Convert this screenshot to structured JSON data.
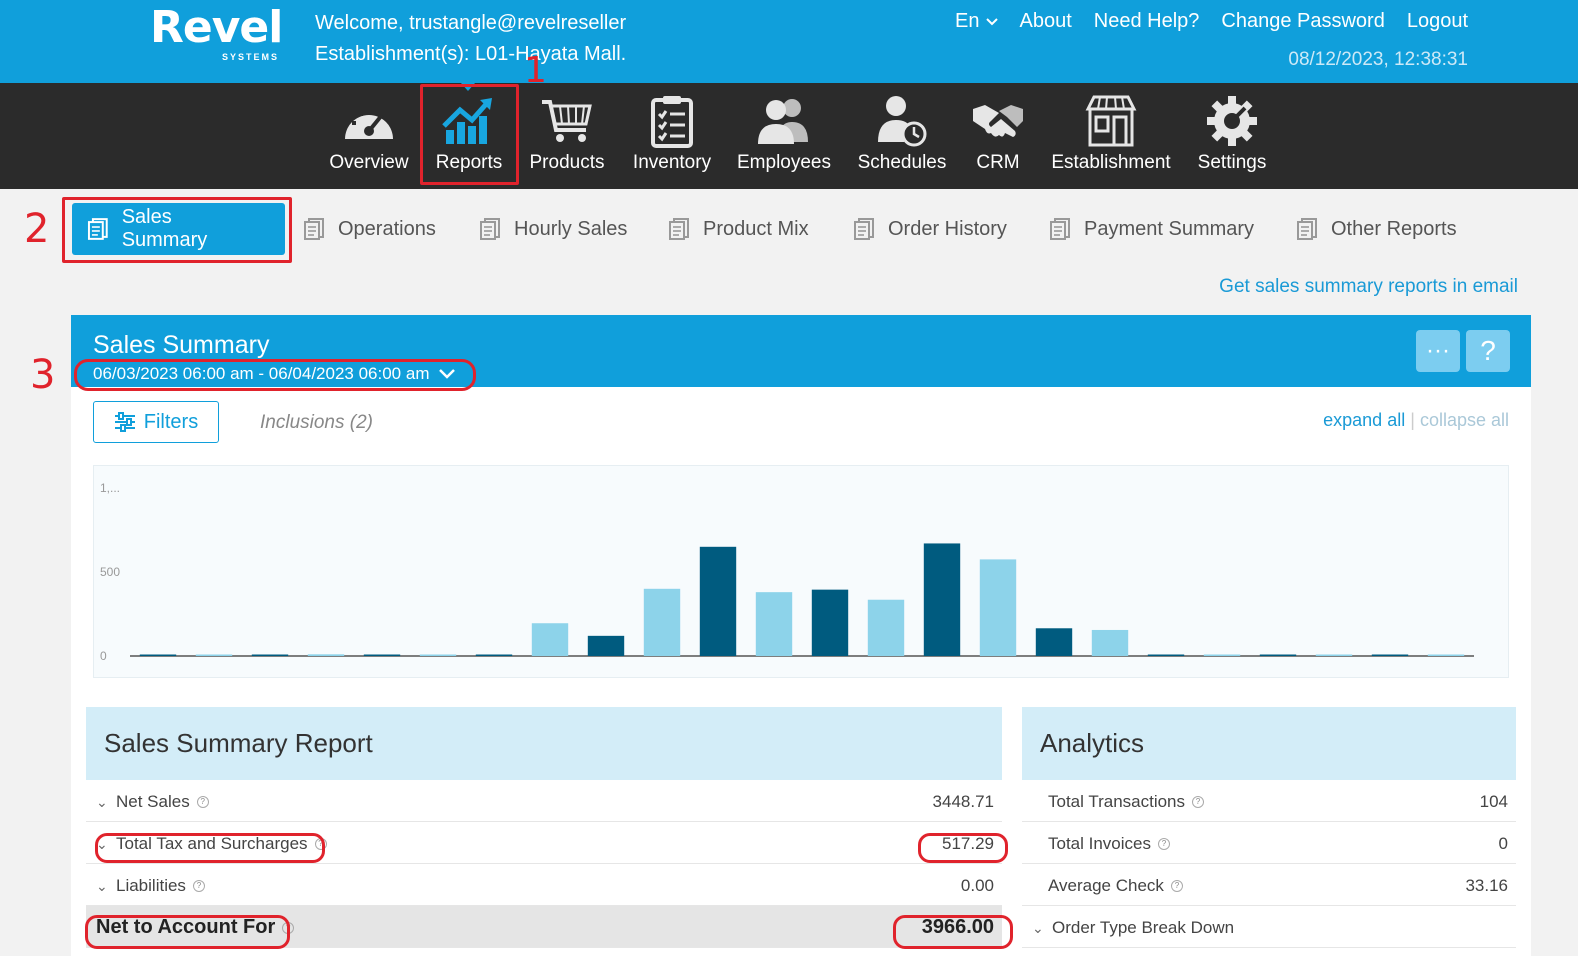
{
  "header": {
    "logo_word": "Revel",
    "logo_sub": "SYSTEMS",
    "welcome": "Welcome, trustangle@revelreseller",
    "establishment": "Establishment(s): L01-Hayata Mall.",
    "links": {
      "lang": "En",
      "about": "About",
      "help": "Need Help?",
      "password": "Change Password",
      "logout": "Logout"
    },
    "datetime": "08/12/2023, 12:38:31"
  },
  "nav": {
    "overview": "Overview",
    "reports": "Reports",
    "products": "Products",
    "inventory": "Inventory",
    "employees": "Employees",
    "schedules": "Schedules",
    "crm": "CRM",
    "establishment": "Establishment",
    "settings": "Settings"
  },
  "annotations": {
    "one": "1",
    "two": "2",
    "three": "3"
  },
  "subtabs": {
    "sales_summary": "Sales Summary",
    "operations": "Operations",
    "hourly_sales": "Hourly Sales",
    "product_mix": "Product Mix",
    "order_history": "Order History",
    "payment_summary": "Payment Summary",
    "other_reports": "Other Reports"
  },
  "email_link": "Get sales summary reports in email",
  "panel": {
    "title": "Sales Summary",
    "date_range": "06/03/2023 06:00 am - 06/04/2023 06:00 am",
    "more_button": "···",
    "help_button": "?",
    "filters": "Filters",
    "inclusions": "Inclusions (2)",
    "expand_all": "expand all",
    "separator": "|",
    "collapse_all": "collapse all"
  },
  "chart_data": {
    "type": "bar",
    "tick_labels": [
      "1,...",
      "500",
      "0"
    ],
    "ylim": [
      0,
      1000
    ],
    "colors": [
      "#005b7f",
      "#8dd3ea"
    ],
    "values": [
      4,
      8,
      3,
      10,
      2,
      8,
      2,
      195,
      120,
      400,
      650,
      380,
      395,
      335,
      670,
      575,
      165,
      155,
      3,
      6,
      2,
      5,
      3,
      6
    ]
  },
  "summary": {
    "title": "Sales Summary Report",
    "rows": [
      {
        "label": "Net Sales",
        "value": "3448.71"
      },
      {
        "label": "Total Tax and Surcharges",
        "value": "517.29"
      },
      {
        "label": "Liabilities",
        "value": "0.00"
      },
      {
        "label": "Net to Account For",
        "value": "3966.00"
      }
    ]
  },
  "analytics": {
    "title": "Analytics",
    "rows": [
      {
        "label": "Total Transactions",
        "value": "104"
      },
      {
        "label": "Total Invoices",
        "value": "0"
      },
      {
        "label": "Average Check",
        "value": "33.16"
      },
      {
        "label": "Order Type Break Down",
        "value": ""
      }
    ]
  },
  "colors": {
    "brand_blue": "#109fdb",
    "nav_dark": "#2b2b2b",
    "annotation_red": "#e0232c"
  }
}
